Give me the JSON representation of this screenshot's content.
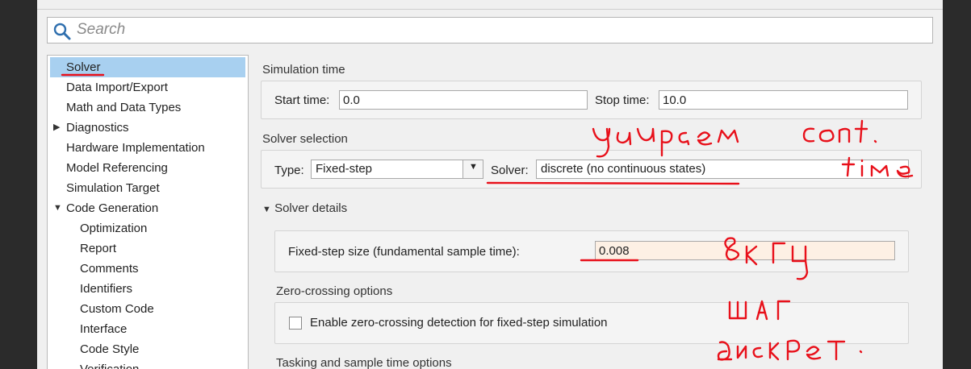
{
  "search": {
    "placeholder": "Search"
  },
  "tree": {
    "items": [
      {
        "label": "Solver",
        "selected": true
      },
      {
        "label": "Data Import/Export"
      },
      {
        "label": "Math and Data Types"
      },
      {
        "label": "Diagnostics",
        "expander": "▶"
      },
      {
        "label": "Hardware Implementation"
      },
      {
        "label": "Model Referencing"
      },
      {
        "label": "Simulation Target"
      },
      {
        "label": "Code Generation",
        "expander": "▼"
      },
      {
        "label": "Optimization"
      },
      {
        "label": "Report"
      },
      {
        "label": "Comments"
      },
      {
        "label": "Identifiers"
      },
      {
        "label": "Custom Code"
      },
      {
        "label": "Interface"
      },
      {
        "label": "Code Style"
      },
      {
        "label": "Verification"
      }
    ]
  },
  "simulation_time": {
    "title": "Simulation time",
    "start_label": "Start time:",
    "start_value": "0.0",
    "stop_label": "Stop time:",
    "stop_value": "10.0"
  },
  "solver_selection": {
    "title": "Solver selection",
    "type_label": "Type:",
    "type_value": "Fixed-step",
    "solver_label": "Solver:",
    "solver_value": "discrete (no continuous states)"
  },
  "solver_details": {
    "title": "Solver details",
    "expander": "▼",
    "fixed_step_label": "Fixed-step size (fundamental sample time):",
    "fixed_step_value": "0.008"
  },
  "zero_crossing": {
    "title": "Zero-crossing options",
    "checkbox_label": "Enable zero-crossing detection for fixed-step simulation",
    "checked": false
  },
  "tasking": {
    "title": "Tasking and sample time options"
  },
  "annotations": {
    "color": "#e8101a",
    "notes": [
      "удираем",
      "cont.",
      "time",
      "8кГц",
      "шаг",
      "дискрет."
    ]
  }
}
